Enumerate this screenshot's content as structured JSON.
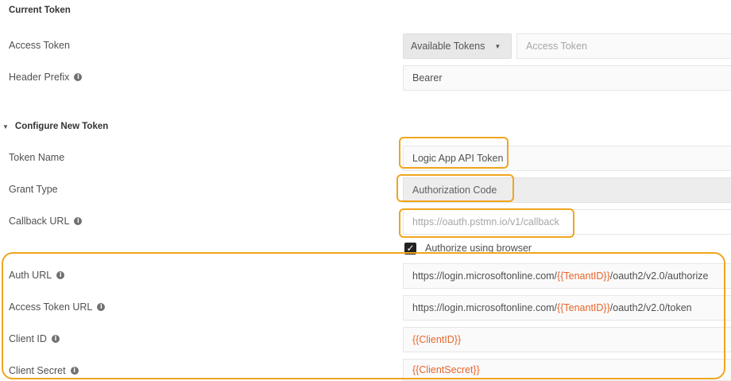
{
  "current_token": {
    "title": "Current Token",
    "access_token_label": "Access Token",
    "available_tokens_label": "Available Tokens",
    "access_token_placeholder": "Access Token",
    "header_prefix_label": "Header Prefix",
    "header_prefix_value": "Bearer"
  },
  "configure": {
    "title": "Configure New Token",
    "token_name_label": "Token Name",
    "token_name_value": "Logic App API Token",
    "grant_type_label": "Grant Type",
    "grant_type_value": "Authorization Code",
    "callback_url_label": "Callback URL",
    "callback_url_value": "https://oauth.pstmn.io/v1/callback",
    "authorize_browser_label": "Authorize using browser",
    "authorize_browser_checked": true,
    "auth_url_label": "Auth URL",
    "auth_url": {
      "prefix": "https://login.microsoftonline.com/",
      "var": "{{TenantID}}",
      "suffix": "/oauth2/v2.0/authorize"
    },
    "access_token_url_label": "Access Token URL",
    "access_token_url": {
      "prefix": "https://login.microsoftonline.com/",
      "var": "{{TenantID}}",
      "suffix": "/oauth2/v2.0/token"
    },
    "client_id_label": "Client ID",
    "client_id_value": "{{ClientID}}",
    "client_secret_label": "Client Secret",
    "client_secret_value": "{{ClientSecret}}"
  },
  "colors": {
    "highlight": "#f0a51e",
    "variable": "#e8652b"
  },
  "icons": {
    "info": "info-icon",
    "dropdown": "caret-down-icon",
    "section_toggle": "triangle-down-icon",
    "check": "check-icon"
  }
}
